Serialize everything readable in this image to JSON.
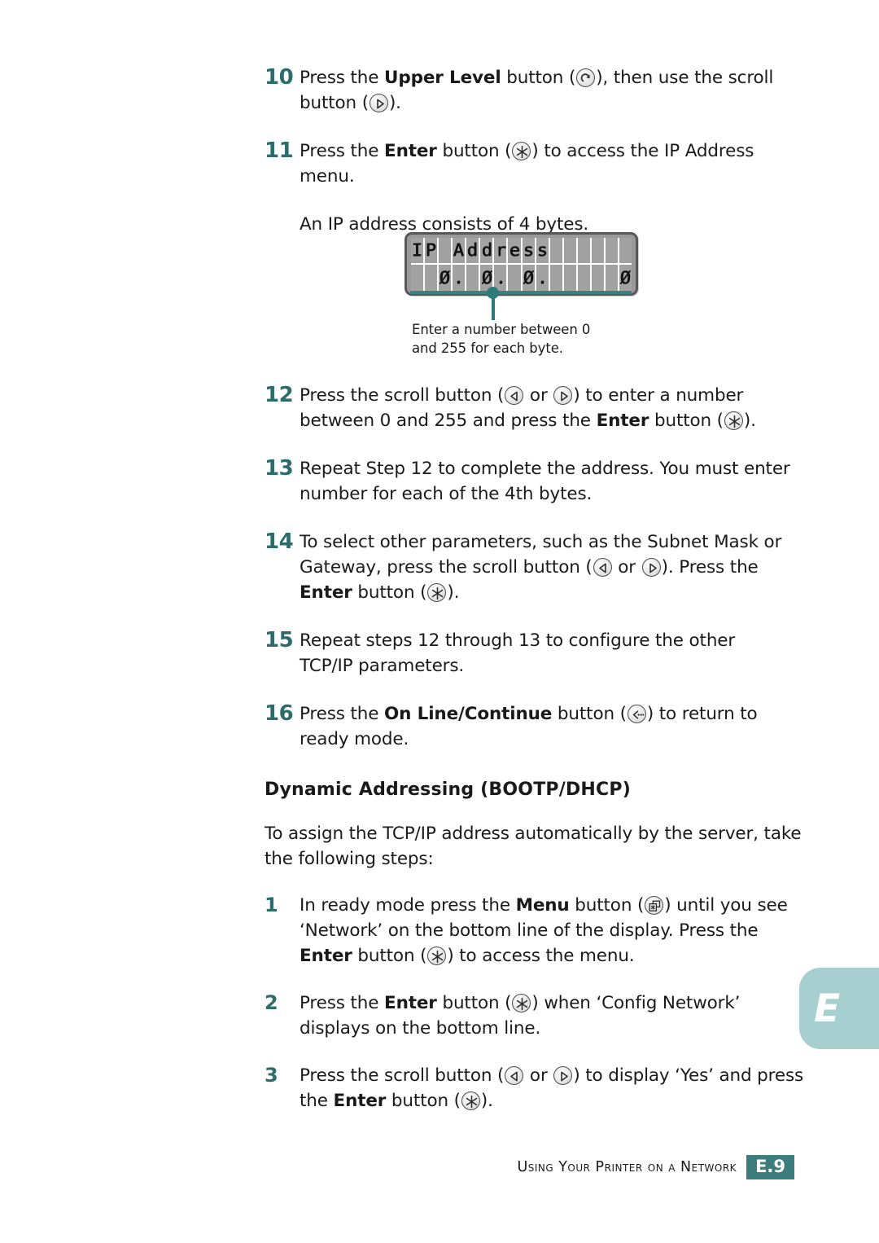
{
  "page": {
    "footer_text": "Using Your Printer on a Network",
    "footer_badge": "E.9",
    "side_tab_letter": "E"
  },
  "steps_upper": [
    {
      "num": "10",
      "html": "Press the <b>Upper Level</b> button (ICON:upper-level), then use the scroll button (ICON:scroll-right)."
    },
    {
      "num": "11",
      "html": "Press the <b>Enter</b> button (ICON:enter) to access the IP Address menu."
    }
  ],
  "note_after_step11": "An IP address consists of 4 bytes.",
  "lcd": {
    "line1": "IP Address",
    "line2": "   0.  0.  0.   0",
    "line1_cells": [
      "I",
      "P",
      "",
      "A",
      "d",
      "d",
      "r",
      "e",
      "s",
      "s",
      "",
      "",
      "",
      "",
      "",
      ""
    ],
    "line2_cells": [
      "",
      "",
      "0",
      ".",
      "",
      "0",
      ".",
      "",
      "0",
      ".",
      "",
      "",
      "",
      "",
      "",
      "0"
    ],
    "callout": "Enter a number between 0\nand 255 for each byte."
  },
  "steps_upper2": [
    {
      "num": "12",
      "html": "Press the scroll button (ICON:scroll-left or ICON:scroll-right) to enter a number between 0 and 255 and press the <b>Enter</b> button (ICON:enter)."
    },
    {
      "num": "13",
      "html": "Repeat Step 12 to complete the address. You must enter number for each of the 4th bytes."
    },
    {
      "num": "14",
      "html": "To select other parameters, such as the Subnet Mask or Gateway, press the scroll button (ICON:scroll-left or ICON:scroll-right). Press the <b>Enter</b> button (ICON:enter)."
    },
    {
      "num": "15",
      "html": "Repeat steps 12 through 13 to configure the other TCP/IP parameters."
    },
    {
      "num": "16",
      "html": "Press the <b>On Line/Continue</b> button (ICON:online-continue) to return to ready mode."
    }
  ],
  "section": {
    "heading": "Dynamic Addressing (BOOTP/DHCP)",
    "intro": "To assign the TCP/IP address automatically by the server, take the following steps:"
  },
  "steps_lower": [
    {
      "num": "1",
      "html": "In ready mode press the <b>Menu</b> button (ICON:menu) until you see ‘Network’ on the bottom line of the display. Press the <b>Enter</b> button (ICON:enter) to access the menu."
    },
    {
      "num": "2",
      "html": "Press the <b>Enter</b> button (ICON:enter) when ‘Config Network’ displays on the bottom line."
    },
    {
      "num": "3",
      "html": "Press the scroll button (ICON:scroll-left or ICON:scroll-right) to display ‘Yes’ and press the <b>Enter</b> button (ICON:enter)."
    }
  ],
  "colors": {
    "step_number": "#2e6b6b",
    "teal_accent": "#3a8080",
    "tab_background": "#a7cfcf",
    "footer_badge": "#3e7d7d"
  }
}
